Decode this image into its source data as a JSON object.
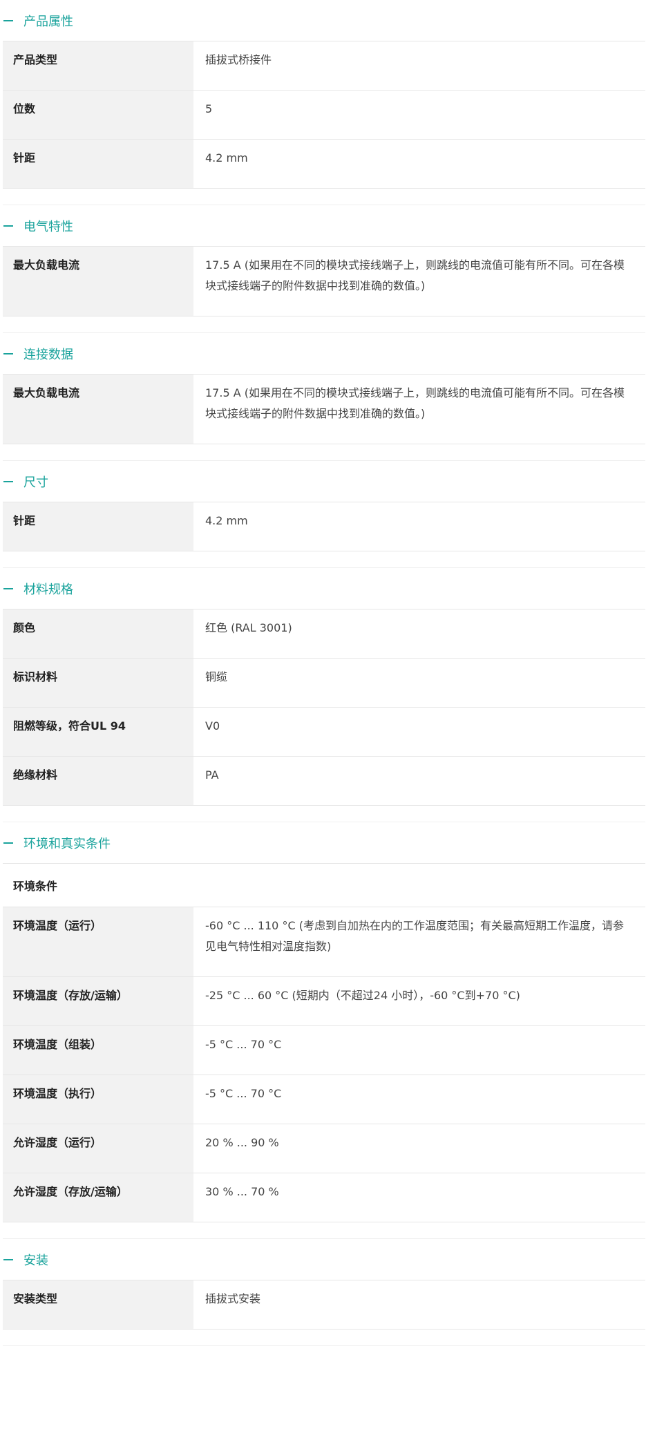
{
  "sections": [
    {
      "title": "产品属性",
      "rows": [
        {
          "label": "产品类型",
          "value": "插拔式桥接件"
        },
        {
          "label": "位数",
          "value": "5"
        },
        {
          "label": "针距",
          "value": "4.2 mm"
        }
      ]
    },
    {
      "title": "电气特性",
      "rows": [
        {
          "label": "最大负载电流",
          "value": "17.5 A (如果用在不同的模块式接线端子上，则跳线的电流值可能有所不同。可在各模块式接线端子的附件数据中找到准确的数值。)"
        }
      ]
    },
    {
      "title": "连接数据",
      "rows": [
        {
          "label": "最大负载电流",
          "value": "17.5 A (如果用在不同的模块式接线端子上，则跳线的电流值可能有所不同。可在各模块式接线端子的附件数据中找到准确的数值。)"
        }
      ]
    },
    {
      "title": "尺寸",
      "rows": [
        {
          "label": "针距",
          "value": "4.2 mm"
        }
      ]
    },
    {
      "title": "材料规格",
      "rows": [
        {
          "label": "颜色",
          "value": "红色 (RAL 3001)"
        },
        {
          "label": "标识材料",
          "value": "铜缆"
        },
        {
          "label": "阻燃等级，符合UL 94",
          "value": "V0"
        },
        {
          "label": "绝缘材料",
          "value": "PA"
        }
      ]
    },
    {
      "title": "环境和真实条件",
      "subheading": "环境条件",
      "rows": [
        {
          "label": "环境温度（运行）",
          "value": "-60 °C ... 110 °C (考虑到自加热在内的工作温度范围；有关最高短期工作温度，请参见电气特性相对温度指数)"
        },
        {
          "label": "环境温度（存放/运输）",
          "value": "-25 °C ... 60 °C (短期内（不超过24 小时），-60 °C到+70 °C)"
        },
        {
          "label": "环境温度（组装）",
          "value": "-5 °C ... 70 °C"
        },
        {
          "label": "环境温度（执行）",
          "value": "-5 °C ... 70 °C"
        },
        {
          "label": "允许湿度（运行）",
          "value": "20 % ... 90 %"
        },
        {
          "label": "允许湿度（存放/运输）",
          "value": "30 % ... 70 %"
        }
      ]
    },
    {
      "title": "安装",
      "rows": [
        {
          "label": "安装类型",
          "value": "插拔式安装"
        }
      ]
    }
  ]
}
